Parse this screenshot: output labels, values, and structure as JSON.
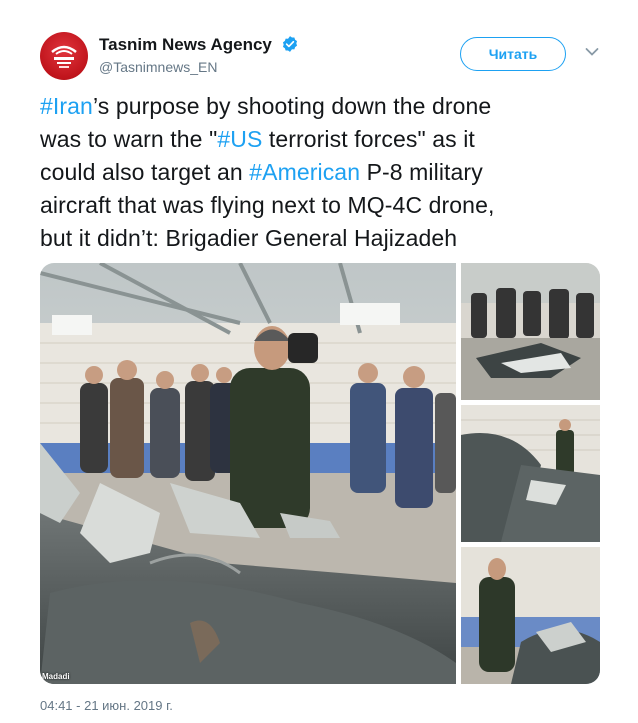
{
  "tweet": {
    "author_name": "Tasnim News Agency",
    "author_handle": "@Tasnimnews_EN",
    "follow_label": "Читать",
    "text_lines": [
      [
        {
          "t": "#Iran",
          "tag": true
        },
        {
          "t": "’s purpose by shooting down the drone",
          "tag": false
        }
      ],
      [
        {
          "t": "was to warn the \"",
          "tag": false
        },
        {
          "t": "#US",
          "tag": true
        },
        {
          "t": " terrorist forces\" as it",
          "tag": false
        }
      ],
      [
        {
          "t": "could also target an ",
          "tag": false
        },
        {
          "t": "#American",
          "tag": true
        },
        {
          "t": " P-8 military",
          "tag": false
        }
      ],
      [
        {
          "t": "aircraft that was flying next to MQ-4C drone,",
          "tag": false
        }
      ],
      [
        {
          "t": "but it didn’t: Brigadier General Hajizadeh",
          "tag": false
        }
      ]
    ],
    "timestamp": "04:41 - 21 июн. 2019 г.",
    "photo_credit": "Madadi"
  },
  "icons": {
    "verified": "verified-badge-icon",
    "menu": "chevron-down-icon"
  },
  "colors": {
    "hashtag": "#1da1f2",
    "accent": "#1da1f2",
    "muted": "#657786",
    "avatar_red": "#c0141c"
  }
}
